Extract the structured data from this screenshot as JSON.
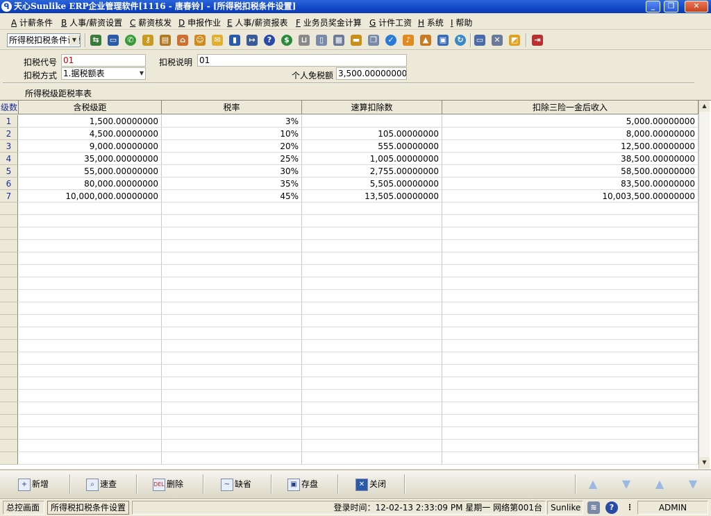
{
  "window": {
    "title": "天心Sunlike ERP企业管理软件[1116 - 唐春铃] - [所得税扣税条件设置]",
    "minimize_glyph": "_",
    "restore_glyph": "❐",
    "close_glyph": "✕"
  },
  "menu": [
    {
      "key": "A",
      "label": "计薪条件"
    },
    {
      "key": "B",
      "label": "人事/薪资设置"
    },
    {
      "key": "C",
      "label": "薪资核发"
    },
    {
      "key": "D",
      "label": "申报作业"
    },
    {
      "key": "E",
      "label": "人事/薪资报表"
    },
    {
      "key": "F",
      "label": "业务员奖金计算"
    },
    {
      "key": "G",
      "label": "计件工资"
    },
    {
      "key": "H",
      "label": "系统"
    },
    {
      "key": "I",
      "label": "帮助"
    }
  ],
  "toolbar": {
    "selector_value": "所得税扣税条件设置",
    "icons": [
      "swap-icon",
      "monitor-icon",
      "phone-icon",
      "key-icon",
      "briefcase-icon",
      "home-icon",
      "people-icon",
      "mail-icon",
      "book-icon",
      "pin-icon",
      "help-icon",
      "dollar-icon",
      "cart-icon",
      "document-icon",
      "calculator-icon",
      "folder-icon",
      "copy-icon",
      "check-icon",
      "bell-icon",
      "tree-icon",
      "screen-icon",
      "refresh-icon",
      "window-icon",
      "close-window-icon",
      "tile-icon",
      "exit-icon"
    ]
  },
  "form": {
    "code_label": "扣税代号",
    "code_value": "01",
    "desc_label": "扣税说明",
    "desc_value": "01",
    "method_label": "扣税方式",
    "method_value": "1.据税额表",
    "exempt_label": "个人免税额",
    "exempt_value": "3,500.00000000",
    "section_title": "所得税级距税率表"
  },
  "grid": {
    "columns": [
      "级数",
      "含税级距",
      "税率",
      "速算扣除数",
      "扣除三险一金后收入"
    ],
    "rows": [
      [
        "1",
        "1,500.00000000",
        "3%",
        "",
        "5,000.00000000"
      ],
      [
        "2",
        "4,500.00000000",
        "10%",
        "105.00000000",
        "8,000.00000000"
      ],
      [
        "3",
        "9,000.00000000",
        "20%",
        "555.00000000",
        "12,500.00000000"
      ],
      [
        "4",
        "35,000.00000000",
        "25%",
        "1,005.00000000",
        "38,500.00000000"
      ],
      [
        "5",
        "55,000.00000000",
        "30%",
        "2,755.00000000",
        "58,500.00000000"
      ],
      [
        "6",
        "80,000.00000000",
        "35%",
        "5,505.00000000",
        "83,500.00000000"
      ],
      [
        "7",
        "10,000,000.00000000",
        "45%",
        "13,505.00000000",
        "10,003,500.00000000"
      ]
    ]
  },
  "actions": {
    "add": "新增",
    "search": "速查",
    "delete": "删除",
    "delete_icon_text": "DEL",
    "default": "缺省",
    "save": "存盘",
    "close": "关闭"
  },
  "status": {
    "home": "总控画面",
    "current": "所得税扣税条件设置",
    "login": "登录时间：12-02-13 2:33:09 PM  星期一   网络第001台",
    "brand": "Sunlike ERP",
    "user": "ADMIN"
  }
}
